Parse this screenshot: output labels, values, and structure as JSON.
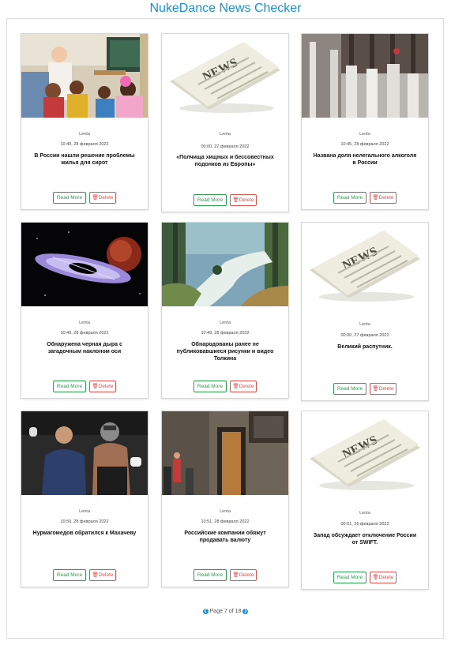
{
  "app": {
    "title": "NukeDance News Checker"
  },
  "buttons": {
    "read_more": "Read More",
    "delete": "Delete"
  },
  "cards": [
    {
      "source": "Lenta",
      "date": "10:40, 28 февраля 2022",
      "headline": "В России нашли решение проблемы жилья для сирот",
      "image": "children-classroom-photo"
    },
    {
      "source": "Lenta",
      "date": "00:00, 27 февраля 2022",
      "headline": "«Полчища хищных и бессовестных подонков из Европы»",
      "image": "newspaper-placeholder"
    },
    {
      "source": "Lenta",
      "date": "10:45, 28 февраля 2022",
      "headline": "Названа доля нелегального алкоголя в России",
      "image": "bottles-photo"
    },
    {
      "source": "Lenta",
      "date": "10:49, 28 февраля 2022",
      "headline": "Обнаружена черная дыра с загадочным наклоном оси",
      "image": "black-hole-illustration"
    },
    {
      "source": "Lenta",
      "date": "10:49, 28 февраля 2022",
      "headline": "Обнародованы ранее не публиковавшиеся рисунки и видео Толкина",
      "image": "tolkien-painting"
    },
    {
      "source": "Lenta",
      "date": "00:00, 27 февраля 2022",
      "headline": "Великий распутник.",
      "image": "newspaper-placeholder"
    },
    {
      "source": "Lenta",
      "date": "10:50, 28 февраля 2022",
      "headline": "Нурмагомедов обратился к Махачеву",
      "image": "fighters-photo"
    },
    {
      "source": "Lenta",
      "date": "10:51, 28 февраля 2022",
      "headline": "Российские компании обяжут продавать валюту",
      "image": "central-bank-building-photo"
    },
    {
      "source": "Lenta",
      "date": "00:01, 26 февраля 2022",
      "headline": "Запад обсуждает отключение России от SWIFT.",
      "image": "newspaper-placeholder"
    }
  ],
  "pagination": {
    "prev_icon": "chevron-left-icon",
    "next_icon": "chevron-right-icon",
    "label": "Page 7 of 18"
  }
}
